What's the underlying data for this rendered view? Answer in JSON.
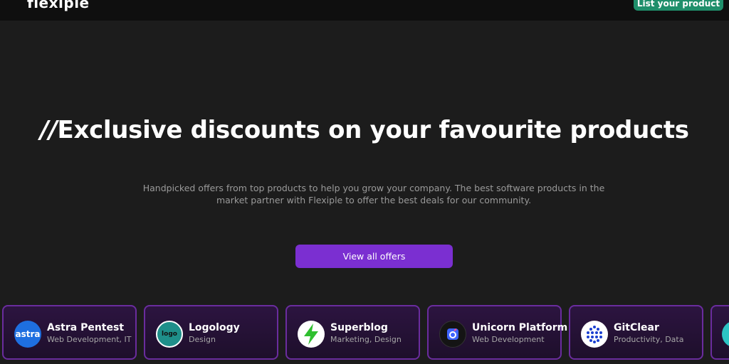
{
  "header": {
    "logo_text": "flexiple",
    "list_button_label": "List your product"
  },
  "hero": {
    "title_prefix": "//",
    "title": "Exclusive discounts on your favourite products",
    "subtitle": "Handpicked offers from top products to help you grow your company. The best software products in the market partner with Flexiple to offer the best deals for our community.",
    "cta_label": "View all offers"
  },
  "cards": [
    {
      "name": "Astra Pentest",
      "category": "Web Development, IT",
      "icon": "astra-logo-icon",
      "icon_text": "astra"
    },
    {
      "name": "Logology",
      "category": "Design",
      "icon": "logology-logo-icon",
      "icon_text": "logo"
    },
    {
      "name": "Superblog",
      "category": "Marketing, Design",
      "icon": "lightning-bolt-icon"
    },
    {
      "name": "Unicorn Platform",
      "category": "Web Development",
      "icon": "unicorn-platform-logo-icon"
    },
    {
      "name": "GitClear",
      "category": "Productivity, Data",
      "icon": "dots-grid-icon"
    }
  ],
  "colors": {
    "background": "#1c1c1c",
    "topbar": "#0f0f0f",
    "accent_green": "#1f8f6b",
    "accent_purple": "#7b2fd1",
    "card_border": "#6a2c9e"
  }
}
